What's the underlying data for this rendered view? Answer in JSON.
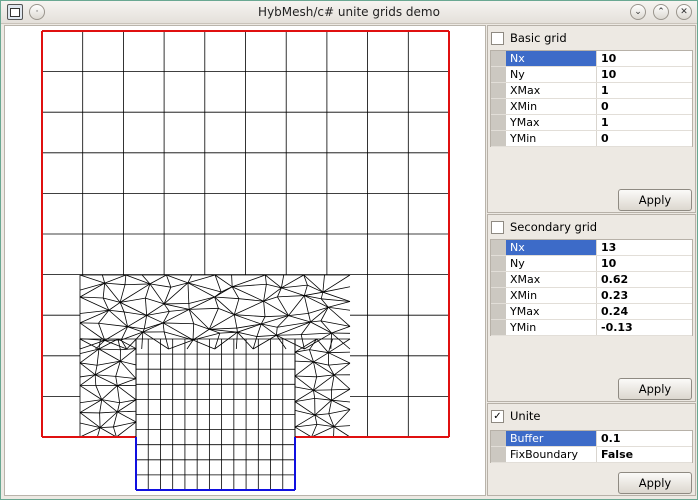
{
  "window": {
    "title": "HybMesh/c# unite grids demo"
  },
  "titlebar_icons": [
    "app-icon",
    "menu-icon",
    "minimize-icon",
    "maximize-icon",
    "close-icon"
  ],
  "basic_grid": {
    "label": "Basic grid",
    "checked": false,
    "props": [
      {
        "name": "Nx",
        "value": "10"
      },
      {
        "name": "Ny",
        "value": "10"
      },
      {
        "name": "XMax",
        "value": "1"
      },
      {
        "name": "XMin",
        "value": "0"
      },
      {
        "name": "YMax",
        "value": "1"
      },
      {
        "name": "YMin",
        "value": "0"
      }
    ],
    "apply_label": "Apply"
  },
  "secondary_grid": {
    "label": "Secondary grid",
    "checked": false,
    "props": [
      {
        "name": "Nx",
        "value": "13"
      },
      {
        "name": "Ny",
        "value": "10"
      },
      {
        "name": "XMax",
        "value": "0.62"
      },
      {
        "name": "XMin",
        "value": "0.23"
      },
      {
        "name": "YMax",
        "value": "0.24"
      },
      {
        "name": "YMin",
        "value": "-0.13"
      }
    ],
    "apply_label": "Apply"
  },
  "unite": {
    "label": "Unite",
    "checked": true,
    "props": [
      {
        "name": "Buffer",
        "value": "0.1"
      },
      {
        "name": "FixBoundary",
        "value": "False"
      }
    ],
    "apply_label": "Apply"
  },
  "colors": {
    "basic_boundary": "#e01010",
    "secondary_boundary": "#1010e0",
    "mesh": "#000000",
    "selection": "#3d6bc8"
  }
}
